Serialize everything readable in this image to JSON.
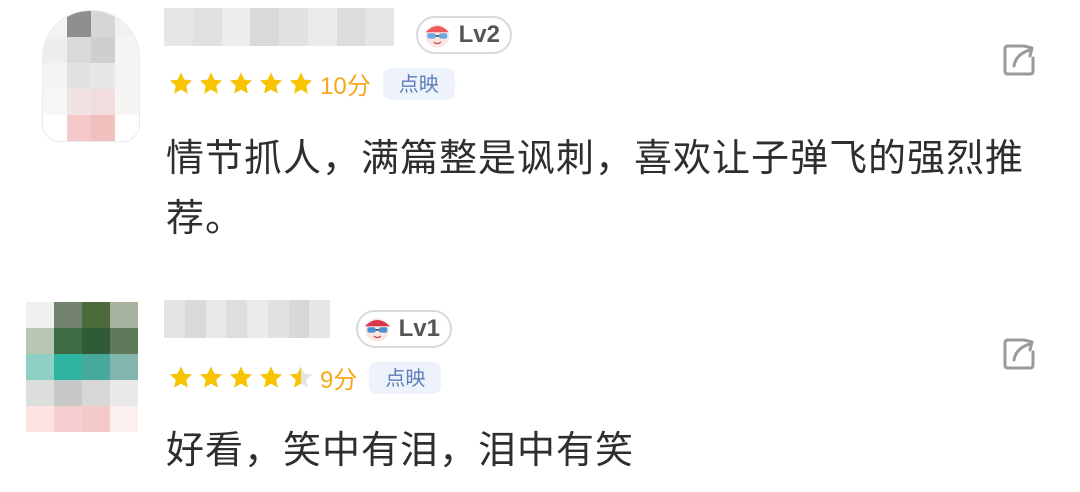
{
  "reviews": [
    {
      "level": "Lv2",
      "score_label": "10分",
      "rating": 5,
      "source_tag": "点映",
      "text": "情节抓人，满篇整是讽刺，喜欢让子弹飞的强烈推荐。",
      "avatar_colors": [
        "#f3f5f4",
        "#8e8e8e",
        "#d6d6d6",
        "#f1f1f1",
        "#eeeeee",
        "#d9d9d9",
        "#cfcfcf",
        "#f5f5f5",
        "#f4f4f4",
        "#e2e2e2",
        "#e7e7e7",
        "#f4f4f4",
        "#f7f7f7",
        "#f0e3e2",
        "#f1dddd",
        "#f7f4f4",
        "#ffffff",
        "#f5c9c9",
        "#f3c0c0",
        "#ffffff"
      ],
      "name_colors": [
        "#e6e6e6",
        "#e0e0e0",
        "#ececec",
        "#d9d9d9",
        "#e2e2e2",
        "#eaeaea",
        "#dcdcdc",
        "#e5e5e5"
      ]
    },
    {
      "level": "Lv1",
      "score_label": "9分",
      "rating": 4.5,
      "source_tag": "点映",
      "text": "好看，笑中有泪，泪中有笑",
      "avatar_colors": [
        "#eef0ee",
        "#73826e",
        "#4c6b3c",
        "#a7b39e",
        "#b8c7b4",
        "#3e6c43",
        "#2f5b36",
        "#5e7a5a",
        "#8fd0c6",
        "#2eb5a2",
        "#47a89c",
        "#82b5ad",
        "#dcdedc",
        "#c6c9c7",
        "#d6d7d6",
        "#e9e9e9",
        "#fbe3e3",
        "#f6d0d0",
        "#f3c9c9",
        "#fbefef"
      ],
      "name_colors": [
        "#e4e4e4",
        "#dadada",
        "#e8e8e8",
        "#dedede",
        "#ebebeb",
        "#e2e2e2",
        "#d8d8d8",
        "#e6e6e6"
      ]
    }
  ],
  "icons": {
    "share": "share-icon",
    "star": "star-icon",
    "level_mascot": "mascot-icon"
  },
  "colors": {
    "star": "#f7c400",
    "score": "#f6a81b",
    "tag_bg": "#eef3fb",
    "tag_text": "#5b7fb8",
    "icon_gray": "#9a9a9a"
  }
}
